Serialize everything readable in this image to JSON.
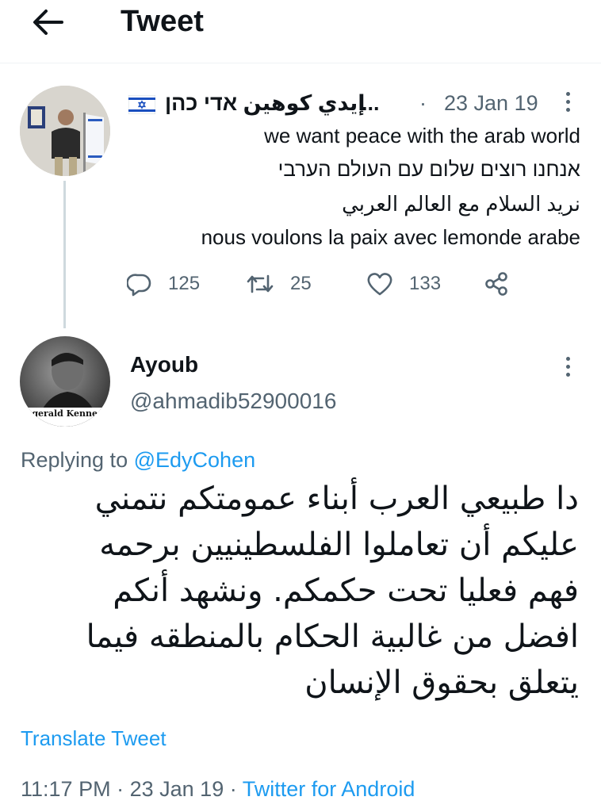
{
  "header": {
    "title": "Tweet",
    "back_icon": "arrow-left-icon"
  },
  "parent_tweet": {
    "flag_icon": "israel-flag-icon",
    "author_name": "إيدي كوهين אדי כהן",
    "ellipsis": "...",
    "separator": "·",
    "date": "23 Jan 19",
    "lines": [
      "we want peace with the arab world",
      "אנחנו רוצים שלום עם העולם הערבי",
      "نريد السلام مع العالم العربي",
      "nous voulons la paix avec lemonde arabe"
    ],
    "replies": "125",
    "retweets": "25",
    "likes": "133"
  },
  "main_tweet": {
    "author_name": "Ayoub",
    "handle": "@ahmadib52900016",
    "replying_prefix": "Replying to",
    "replying_to": "@EdyCohen",
    "text_lines": [
      "دا طبيعي العرب أبناء عمومتكم نتمني",
      "عليكم أن تعاملوا الفلسطينيين برحمه",
      "فهم فعليا تحت حكمكم. ونشهد أنكم",
      "افضل من غالبية الحكام بالمنطقه فيما",
      "يتعلق بحقوق الإنسان"
    ],
    "translate_label": "Translate Tweet",
    "time": "11:17 PM",
    "date": "23 Jan 19",
    "source": "Twitter for Android",
    "sep": "·",
    "avatar_caption": "tzgerald Kenned"
  },
  "colors": {
    "accent": "#1d9bf0",
    "muted": "#536471",
    "text": "#0f1419"
  }
}
